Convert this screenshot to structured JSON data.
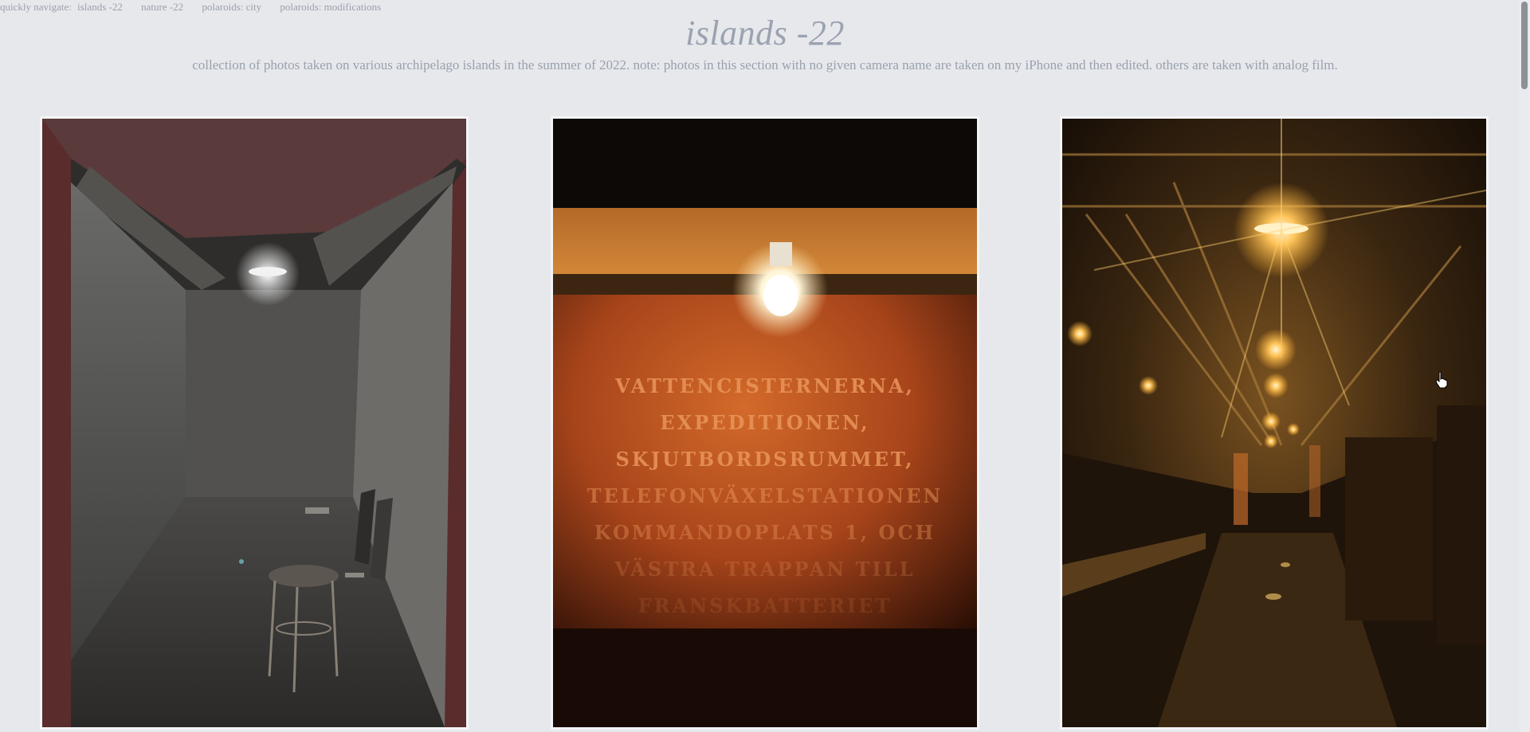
{
  "quicknav": {
    "label": "quickly navigate:",
    "links": [
      "islands -22",
      "nature -22",
      "polaroids: city",
      "polaroids: modifications"
    ]
  },
  "header": {
    "title": "islands -22",
    "subtitle": "collection of photos taken on various archipelago islands in the summer of 2022. note: photos in this section with no given camera name are taken on my iPhone and then edited. others are taken with analog film."
  },
  "photos": [
    {
      "name": "grey-concrete-room-with-stool",
      "tone": "#4a4a48"
    },
    {
      "name": "orange-wall-with-bulb",
      "tone": "#c3571f",
      "wall_text": [
        "VATTENCISTERNERNA,",
        "EXPEDITIONEN,",
        "SKJUTBORDSRUMMET,",
        "TELEFONVÄXELSTATIONEN",
        "KOMMANDOPLATS 1, OCH",
        "VÄSTRA TRAPPAN TILL",
        "FRANSKBATTERIET"
      ]
    },
    {
      "name": "amber-tunnel-with-lights",
      "tone": "#3a2a12"
    }
  ],
  "colors": {
    "background": "#e6e8ec",
    "text": "#9aa1ad",
    "frame": "#f4f5f7"
  }
}
